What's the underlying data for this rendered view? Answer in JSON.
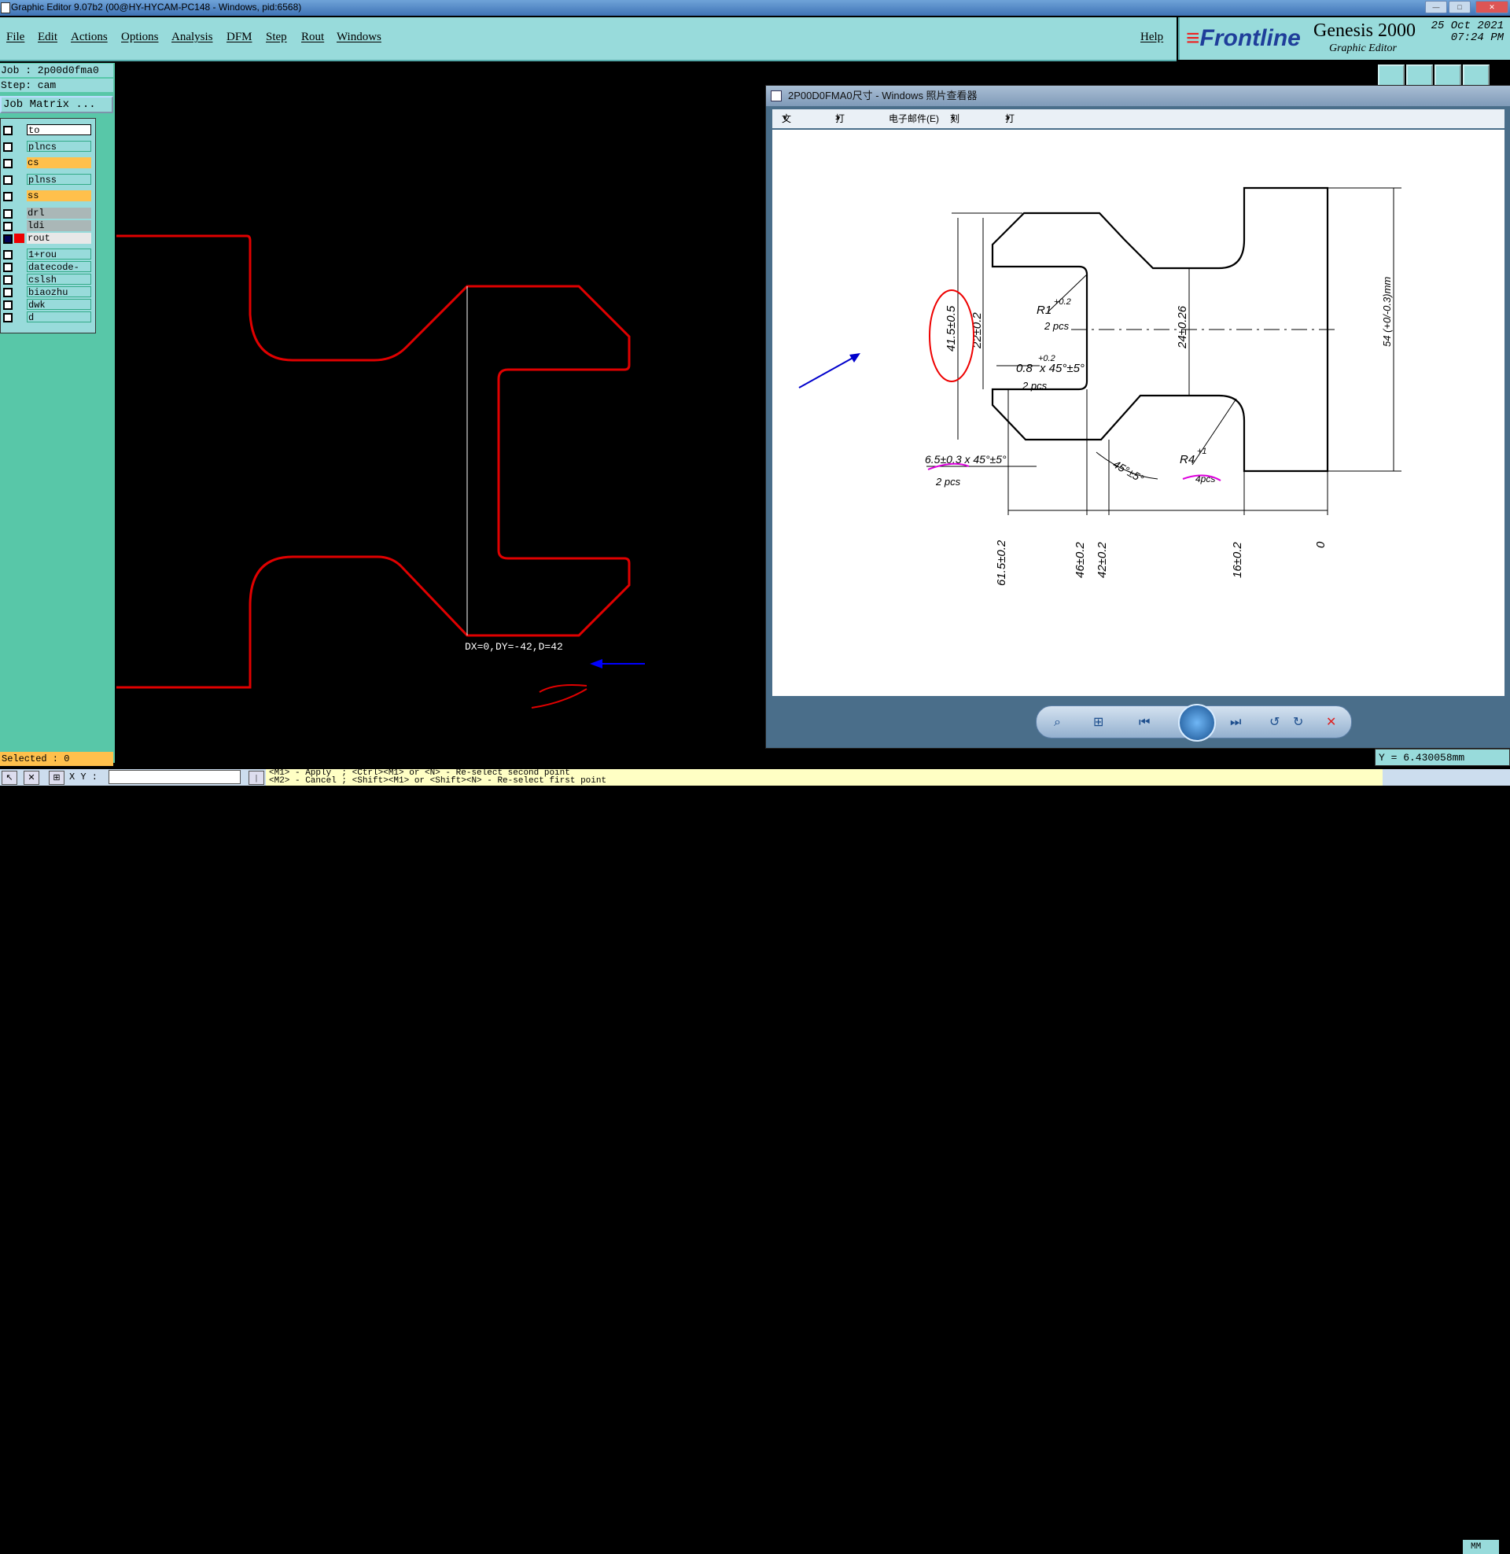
{
  "window": {
    "title": "Graphic Editor 9.07b2 (00@HY-HYCAM-PC148 - Windows, pid:6568)"
  },
  "menu": {
    "items": [
      "File",
      "Edit",
      "Actions",
      "Options",
      "Analysis",
      "DFM",
      "Step",
      "Rout",
      "Windows"
    ],
    "help": "Help"
  },
  "brand": {
    "logo": "Frontline",
    "product": "Genesis 2000",
    "subtitle": "Graphic Editor",
    "date": "25 Oct 2021",
    "time": "07:24 PM"
  },
  "job": {
    "job_label": "Job : 2p00d0fma0",
    "step_label": "Step: cam",
    "job_matrix": "Job Matrix ..."
  },
  "layers": [
    {
      "name": "to",
      "color": "#ffffff"
    },
    {
      "name": "plncs",
      "color": "#98dbdb"
    },
    {
      "name": "cs",
      "color": "#ffc04c"
    },
    {
      "name": "plnss",
      "color": "#98dbdb"
    },
    {
      "name": "ss",
      "color": "#ffc04c"
    },
    {
      "name": "drl",
      "color": "#aab7b7"
    },
    {
      "name": "ldi",
      "color": "#aab7b7"
    },
    {
      "name": "rout",
      "color": "#e8e8e8",
      "active": true
    },
    {
      "name": "1+rou",
      "color": "#98dbdb"
    },
    {
      "name": "datecode-to",
      "color": "#98dbdb"
    },
    {
      "name": "cslsh",
      "color": "#98dbdb"
    },
    {
      "name": "biaozhu",
      "color": "#98dbdb"
    },
    {
      "name": "dwk",
      "color": "#98dbdb"
    },
    {
      "name": "d",
      "color": "#98dbdb"
    }
  ],
  "status": {
    "selected": "Selected : 0",
    "xy_label": "X Y :",
    "message_line1": "<M1> - Apply  ; <Ctrl><M1> or <N> - Re-select second point",
    "message_line2": "<M2> - Cancel ; <Shift><M1> or <Shift><N> - Re-select first point",
    "measurement": "DX=0,DY=-42,D=42",
    "y_readout": "Y = 6.430058mm",
    "units": "MM"
  },
  "viewer": {
    "title": "2P00D0FMA0尺寸 - Windows 照片查看器",
    "menu": [
      "文件(F)",
      "打印(P)",
      "电子邮件(E)",
      "刻录(U)",
      "打开(O)"
    ],
    "drawing": {
      "dims": [
        "41.5±0.5",
        "22±0.2",
        "24±0.26",
        "54 (+0/-0.3)mm",
        "R1",
        "+0.2",
        "2 pcs",
        "0.8",
        "x 45°±5°",
        "+0.2",
        "2 pcs",
        "6.5±0.3 x 45°±5°",
        "2 pcs",
        "45°±5°",
        "R4",
        "+1",
        "4pcs",
        "61.5±0.2",
        "46±0.2",
        "42±0.2",
        "16±0.2",
        "0"
      ]
    }
  },
  "colors": {
    "accent_bg": "#98dbdb",
    "panel_bg": "#58c7a8",
    "rout_line": "#e00000",
    "highlight": "#ffc04c"
  }
}
